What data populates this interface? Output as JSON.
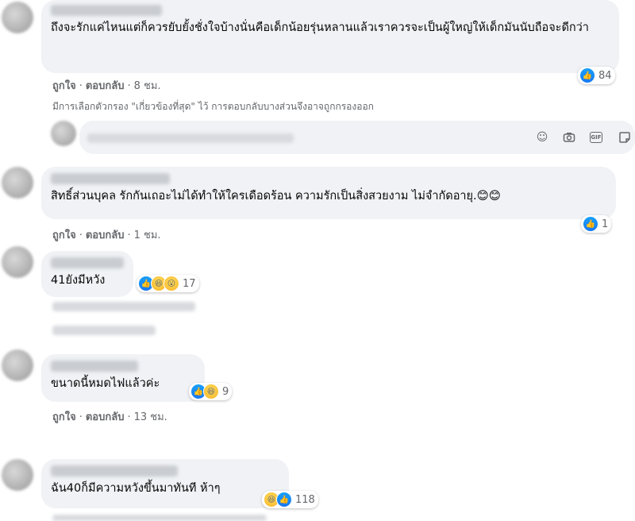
{
  "comments": [
    {
      "text": "ถึงจะรักแค่ไหนแต่ก็ควรยับยั้งชั่งใจบ้างนั่นคือเด็กน้อยรุ่นหลานแล้วเราควรจะเป็นผู้ใหญ่ให้เด็กมันนับถือจะดีกว่า",
      "like_label": "ถูกใจ",
      "reply_label": "ตอบกลับ",
      "time": "8 ชม.",
      "reaction_count": "84"
    },
    {
      "text": "สิทธิ์ส่วนบุคล รักกันเถอะไม่ได้ทำให้ใครเดือดร้อน ความรักเป็นสิ่งสวยงาม ไม่จำกัดอายุ.😊😊",
      "like_label": "ถูกใจ",
      "reply_label": "ตอบกลับ",
      "time": "1 ชม.",
      "reaction_count": "1"
    },
    {
      "text": "41ยังมีหวัง",
      "reaction_count": "17"
    },
    {
      "text": "ขนาดนี้หมดไฟแล้วค่ะ",
      "like_label": "ถูกใจ",
      "reply_label": "ตอบกลับ",
      "time": "13 ชม.",
      "reaction_count": "9"
    },
    {
      "text": "ฉัน40ก็มีความหวังขึ้นมาทันที ห้าๆ",
      "reaction_count": "118"
    }
  ],
  "filter_notice": "มีการเลือกตัวกรอง \"เกี่ยวข้องที่สุด\" ไว้ การตอบกลับบางส่วนจึงอาจถูกกรองออก",
  "composer": {
    "icons": [
      "emoji-icon",
      "camera-icon",
      "gif-icon",
      "sticker-icon"
    ],
    "gif_label": "GIF"
  },
  "colors": {
    "bubble": "#f0f2f5",
    "meta_text": "#65676b",
    "like_blue": "#1877f2"
  }
}
